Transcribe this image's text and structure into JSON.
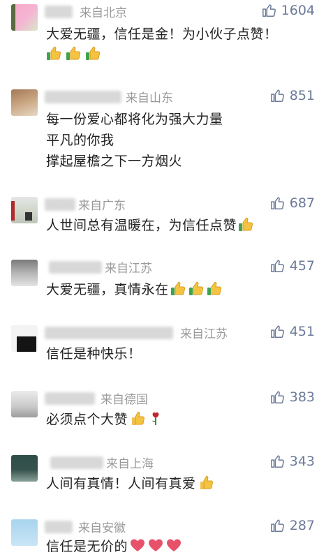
{
  "like_color": "#6b7a99",
  "comments": [
    {
      "location": "来自北京",
      "likes": "1604",
      "lines": [
        "大爱无疆，信任是金！为小伙子点赞！"
      ],
      "emoji_line": [
        "thumbs-up-icon",
        "thumbs-up-icon",
        "thumbs-up-icon"
      ]
    },
    {
      "location": "来自山东",
      "likes": "851",
      "lines": [
        "每一份爱心都将化为强大力量",
        "平凡的你我",
        "撑起屋檐之下一方烟火"
      ]
    },
    {
      "location": "来自广东",
      "likes": "687",
      "lines": [
        "人世间总有温暖在，为信任点赞"
      ],
      "inline_emojis": [
        "thumbs-up-icon"
      ]
    },
    {
      "location": "来自江苏",
      "likes": "457",
      "lines": [
        "大爱无疆，真情永在"
      ],
      "inline_emojis": [
        "thumbs-up-icon",
        "thumbs-up-icon",
        "thumbs-up-icon"
      ]
    },
    {
      "location": "来自江苏",
      "likes": "451",
      "lines": [
        "信任是种快乐！"
      ]
    },
    {
      "location": "来自德国",
      "likes": "383",
      "lines": [
        "必须点个大赞"
      ],
      "inline_emojis": [
        "thumbs-up-icon",
        "rose-icon"
      ]
    },
    {
      "location": "来自上海",
      "likes": "343",
      "lines": [
        "人间有真情！人间有真爱"
      ],
      "inline_emojis": [
        "thumbs-up-icon"
      ]
    },
    {
      "location": "来自安徽",
      "likes": "287",
      "lines": [
        "信任是无价的"
      ],
      "inline_emojis": [
        "heart-icon",
        "heart-icon",
        "heart-icon"
      ]
    }
  ]
}
